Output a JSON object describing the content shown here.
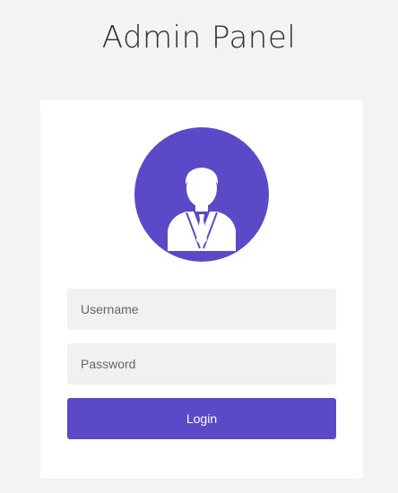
{
  "header": {
    "title": "Admin Panel"
  },
  "login_form": {
    "avatar_icon": "user-tie-icon",
    "username_placeholder": "Username",
    "username_value": "",
    "password_placeholder": "Password",
    "password_value": "",
    "login_label": "Login"
  },
  "colors": {
    "background": "#f3f3f3",
    "card": "#ffffff",
    "accent": "#5b4ac8",
    "field_background": "#f1f1f1"
  }
}
